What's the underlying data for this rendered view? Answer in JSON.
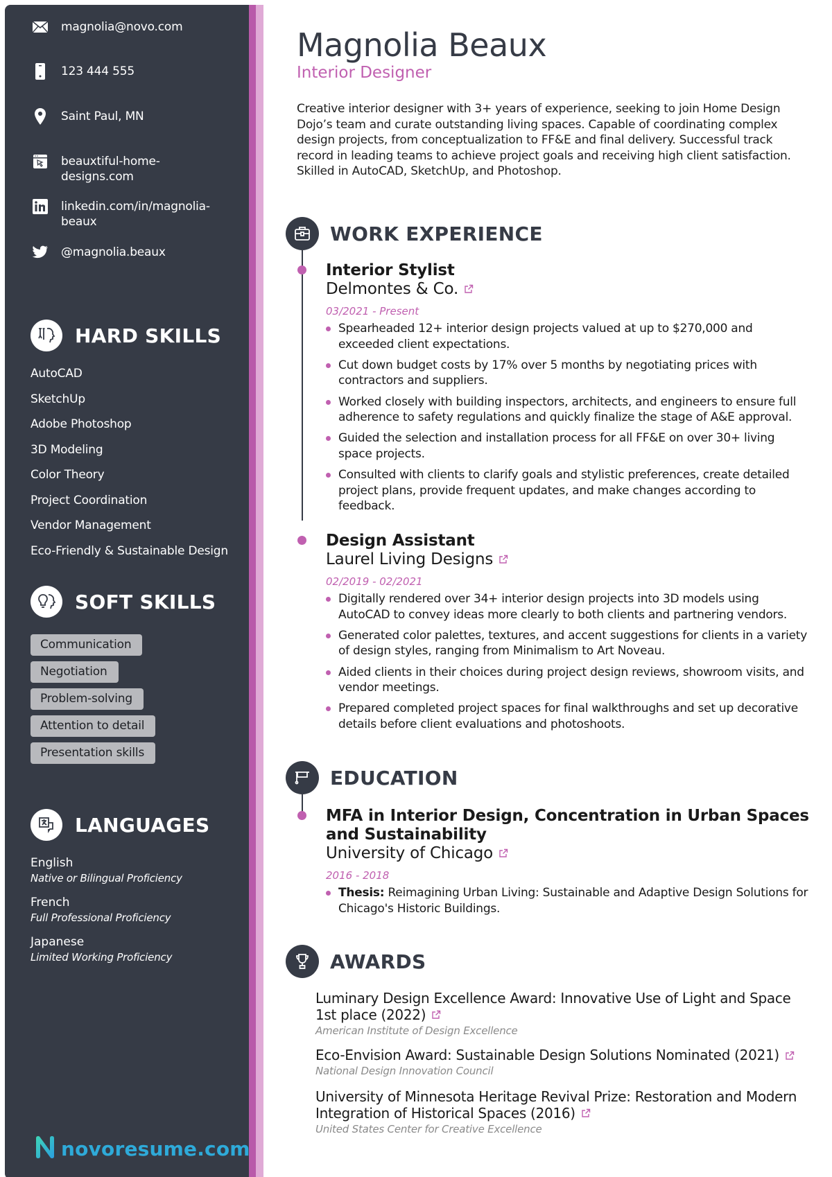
{
  "profile": {
    "name": "Magnolia Beaux",
    "title": "Interior Designer",
    "summary": "Creative interior designer with 3+ years of experience, seeking to join Home Design Dojo’s team and curate outstanding living spaces. Capable of coordinating complex design projects, from conceptualization to FF&E and final delivery. Successful track record in leading teams to achieve project goals and receiving high client satisfaction. Skilled in AutoCAD, SketchUp, and Photoshop."
  },
  "contacts": [
    {
      "icon": "envelope-icon",
      "text": "magnolia@novo.com"
    },
    {
      "icon": "phone-icon",
      "text": "123 444 555"
    },
    {
      "icon": "location-pin-icon",
      "text": "Saint Paul, MN"
    },
    {
      "icon": "website-icon",
      "text": "beauxtiful-home-designs.com"
    },
    {
      "icon": "linkedin-icon",
      "text": "linkedin.com/in/magnolia-beaux"
    },
    {
      "icon": "twitter-icon",
      "text": "@magnolia.beaux"
    }
  ],
  "hard_skills": {
    "heading": "HARD SKILLS",
    "icon": "tools-head-icon",
    "items": [
      "AutoCAD",
      "SketchUp",
      "Adobe Photoshop",
      "3D Modeling",
      "Color Theory",
      "Project Coordination",
      "Vendor Management",
      "Eco-Friendly & Sustainable Design"
    ]
  },
  "soft_skills": {
    "heading": "SOFT SKILLS",
    "icon": "lightbulb-head-icon",
    "items": [
      "Communication",
      "Negotiation",
      "Problem-solving",
      "Attention to detail",
      "Presentation skills"
    ]
  },
  "languages": {
    "heading": "LANGUAGES",
    "icon": "translate-icon",
    "items": [
      {
        "name": "English",
        "level": "Native or Bilingual Proficiency"
      },
      {
        "name": "French",
        "level": "Full Professional Proficiency"
      },
      {
        "name": "Japanese",
        "level": "Limited Working Proficiency"
      }
    ]
  },
  "brand": {
    "text": "novoresume.com",
    "color": "#2eaad9"
  },
  "work": {
    "heading": "WORK EXPERIENCE",
    "icon": "briefcase-icon",
    "jobs": [
      {
        "role": "Interior Stylist",
        "company": "Delmontes & Co.",
        "dates": "03/2021 - Present",
        "bullets": [
          "Spearheaded 12+ interior design projects valued at up to $270,000 and exceeded client expectations.",
          "Cut down budget costs by 17% over 5 months by negotiating prices with contractors and suppliers.",
          "Worked closely with building inspectors, architects, and engineers to ensure full adherence to safety regulations and quickly finalize the stage of A&E approval.",
          "Guided the selection and installation process for all FF&E on over 30+ living space projects.",
          "Consulted with clients to clarify goals and stylistic preferences, create detailed project plans, provide frequent updates, and make changes according to feedback."
        ]
      },
      {
        "role": "Design Assistant",
        "company": "Laurel Living Designs",
        "dates": "02/2019 - 02/2021",
        "bullets": [
          "Digitally rendered over 34+ interior design projects into 3D models using AutoCAD to convey ideas more clearly to both clients and partnering vendors.",
          "Generated color palettes, textures, and accent suggestions for clients in a variety of design styles, ranging from Minimalism to Art Noveau.",
          "Aided clients in their choices during project design reviews, showroom visits, and vendor meetings.",
          "Prepared completed project spaces for final walkthroughs and set up decorative details before client evaluations and photoshoots."
        ]
      }
    ]
  },
  "education": {
    "heading": "EDUCATION",
    "icon": "graduation-cap-icon",
    "degree": "MFA in Interior Design, Concentration in Urban Spaces and Sustainability",
    "school": "University of Chicago",
    "dates": "2016 - 2018",
    "thesis_label": "Thesis:",
    "thesis_text": " Reimagining Urban Living: Sustainable and Adaptive Design Solutions for Chicago's Historic Buildings."
  },
  "awards": {
    "heading": "AWARDS",
    "icon": "trophy-icon",
    "items": [
      {
        "title": "Luminary Design Excellence Award: Innovative Use of Light and Space 1st place (2022)",
        "org": "American Institute of Design Excellence"
      },
      {
        "title": "Eco-Envision Award: Sustainable Design Solutions Nominated (2021)",
        "org": "National Design Innovation Council"
      },
      {
        "title": "University of Minnesota Heritage Revival Prize: Restoration and Modern Integration of Historical Spaces (2016)",
        "org": "United States Center for Creative Excellence"
      }
    ]
  },
  "colors": {
    "sidebar": "#363b46",
    "accent": "#c060b0",
    "accent_light": "#e0aad6",
    "chip": "#b8b9bd"
  }
}
